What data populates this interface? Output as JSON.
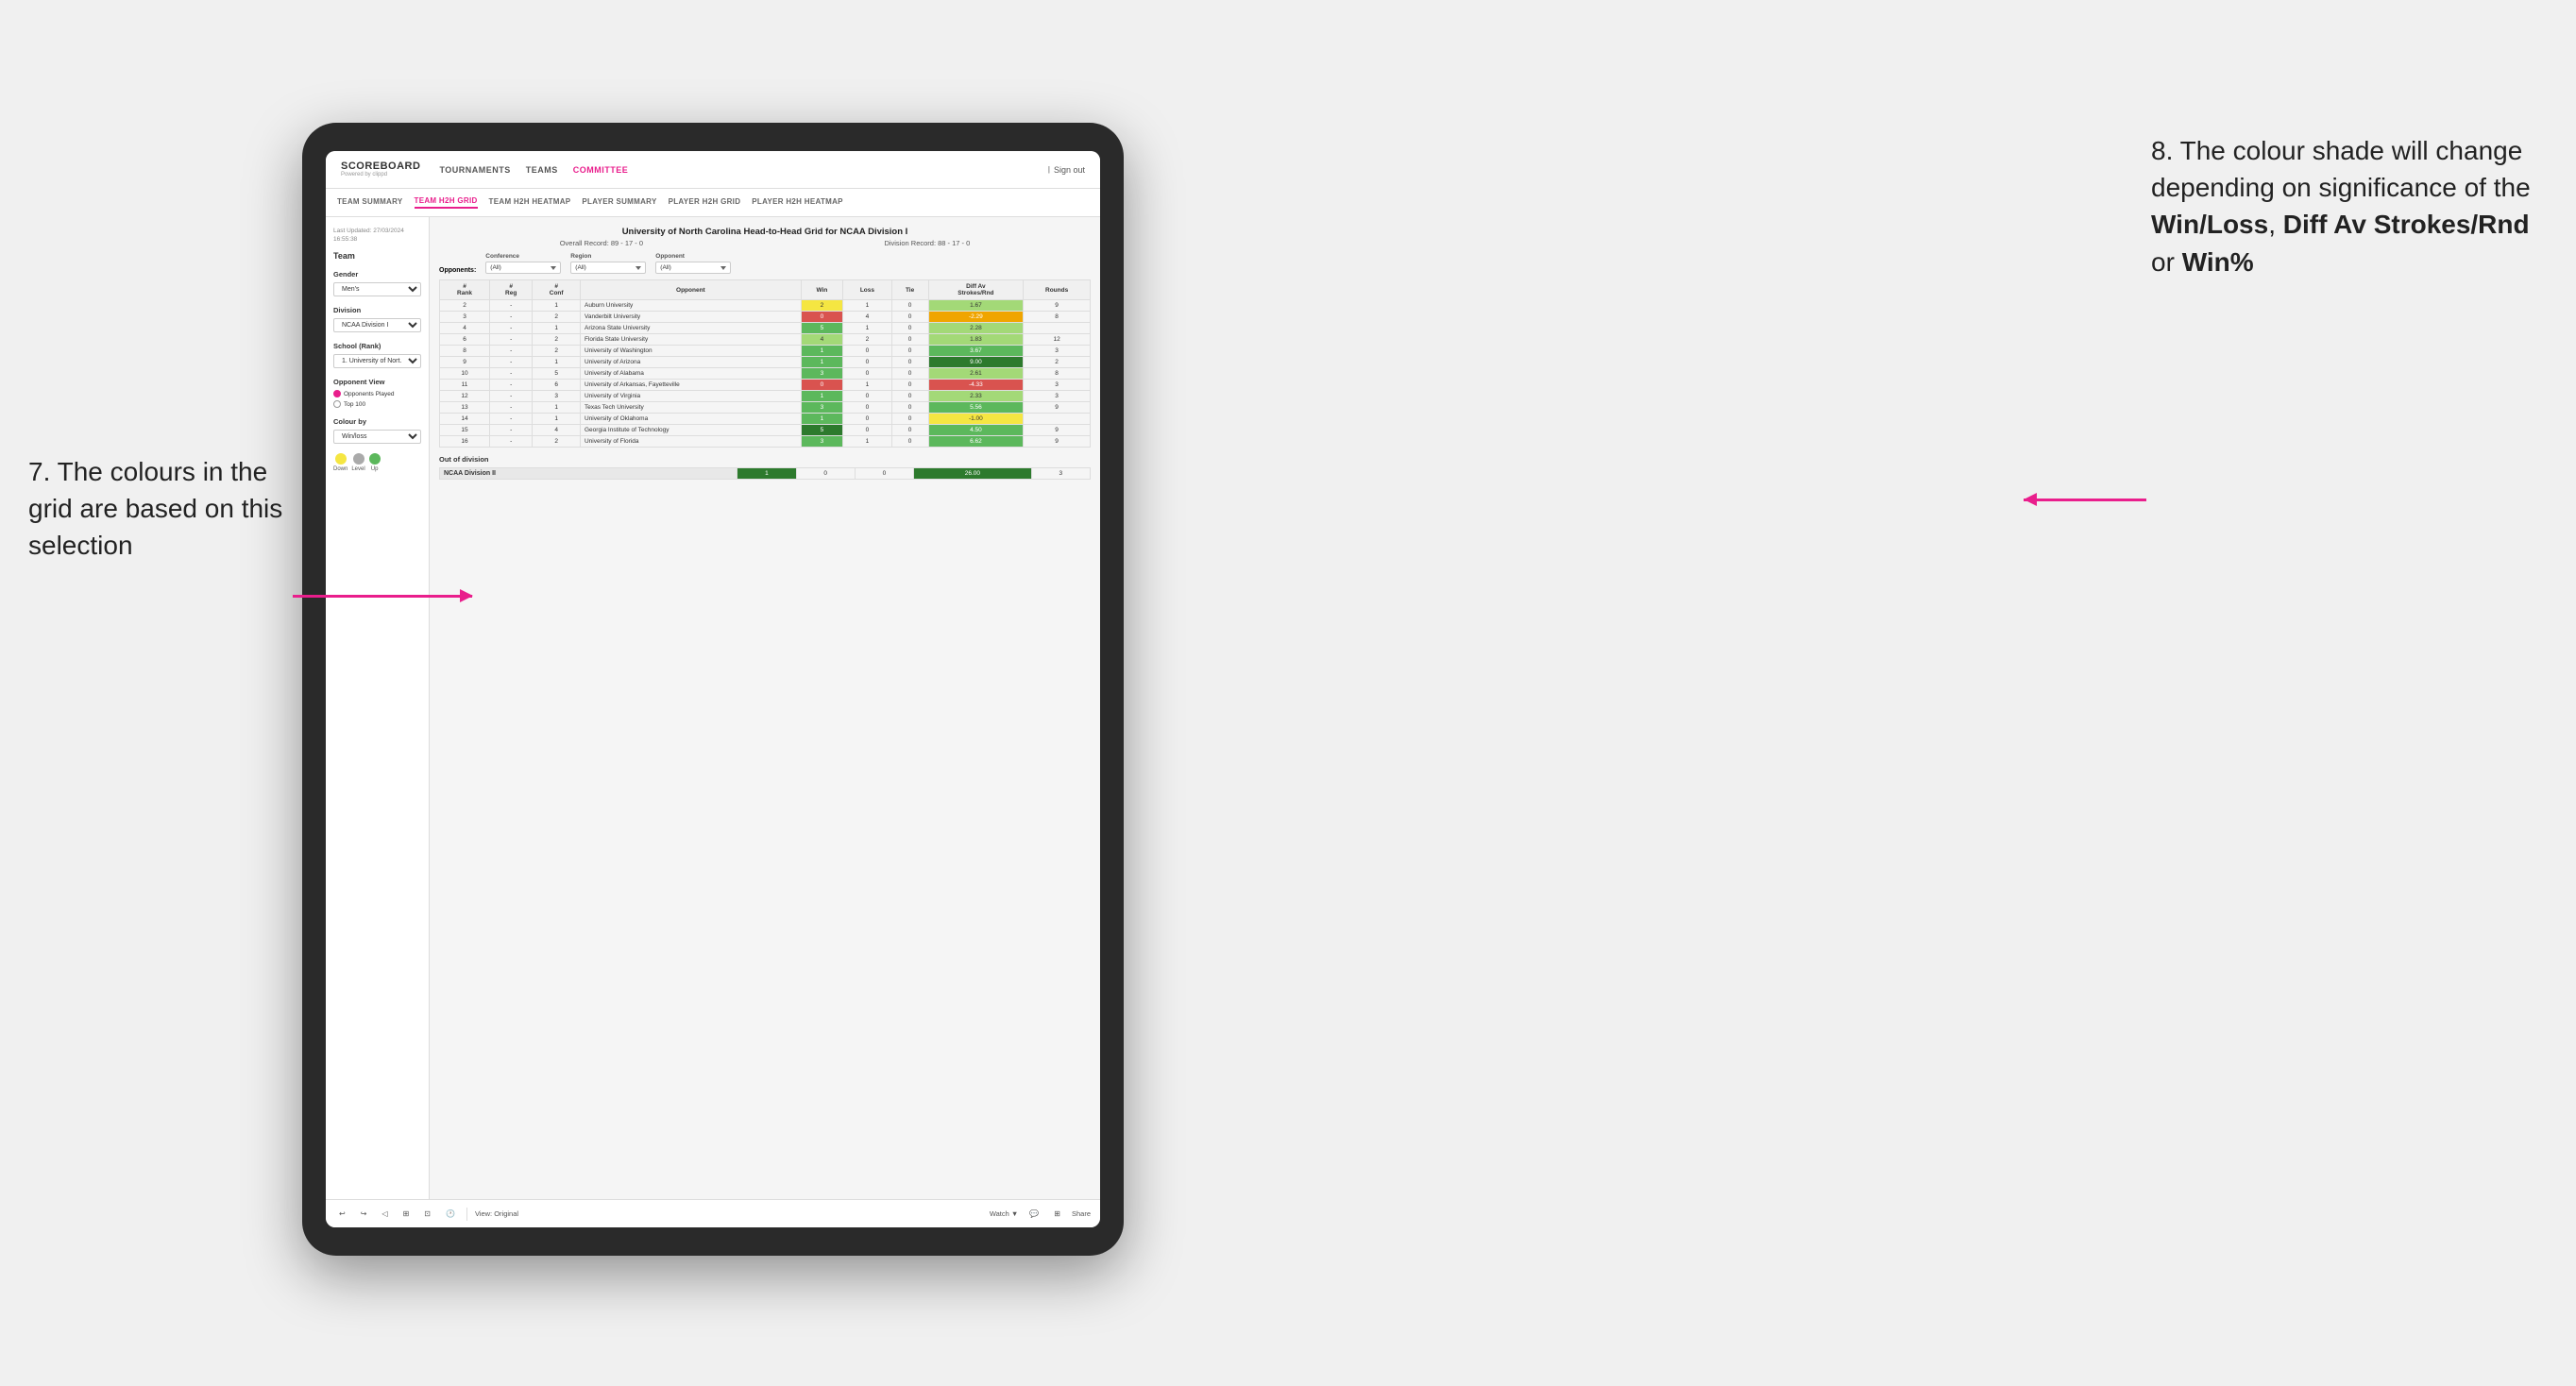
{
  "annotations": {
    "left_text": "7. The colours in the grid are based on this selection",
    "right_text_1": "8. The colour shade will change depending on significance of the",
    "right_bold_1": "Win/Loss",
    "right_bold_2": "Diff Av Strokes/Rnd",
    "right_text_2": "or",
    "right_bold_3": "Win%"
  },
  "nav": {
    "logo": "SCOREBOARD",
    "logo_sub": "Powered by clippd",
    "items": [
      "TOURNAMENTS",
      "TEAMS",
      "COMMITTEE"
    ],
    "sign_out": "Sign out"
  },
  "sub_nav": {
    "items": [
      "TEAM SUMMARY",
      "TEAM H2H GRID",
      "TEAM H2H HEATMAP",
      "PLAYER SUMMARY",
      "PLAYER H2H GRID",
      "PLAYER H2H HEATMAP"
    ],
    "active": "TEAM H2H GRID"
  },
  "left_panel": {
    "last_updated_label": "Last Updated: 27/03/2024",
    "last_updated_time": "16:55:38",
    "team_label": "Team",
    "gender_label": "Gender",
    "gender_value": "Men's",
    "division_label": "Division",
    "division_value": "NCAA Division I",
    "school_label": "School (Rank)",
    "school_value": "1. University of Nort...",
    "opponent_view_label": "Opponent View",
    "radio_options": [
      "Opponents Played",
      "Top 100"
    ],
    "radio_checked": "Opponents Played",
    "colour_by_label": "Colour by",
    "colour_by_value": "Win/loss",
    "legend": {
      "down_label": "Down",
      "level_label": "Level",
      "up_label": "Up",
      "down_color": "#f5e642",
      "level_color": "#aaaaaa",
      "up_color": "#5cb85c"
    }
  },
  "grid": {
    "title": "University of North Carolina Head-to-Head Grid for NCAA Division I",
    "overall_record": "Overall Record: 89 - 17 - 0",
    "division_record": "Division Record: 88 - 17 - 0",
    "filters": {
      "opponents_label": "Opponents:",
      "conference_label": "Conference",
      "conference_value": "(All)",
      "region_label": "Region",
      "region_value": "(All)",
      "opponent_label": "Opponent",
      "opponent_value": "(All)"
    },
    "table_headers": [
      "#\nRank",
      "#\nReg",
      "#\nConf",
      "Opponent",
      "Win",
      "Loss",
      "Tie",
      "Diff Av\nStrokes/Rnd",
      "Rounds"
    ],
    "rows": [
      {
        "rank": "2",
        "reg": "-",
        "conf": "1",
        "opponent": "Auburn University",
        "win": "2",
        "loss": "1",
        "tie": "0",
        "diff": "1.67",
        "rounds": "9",
        "win_color": "yellow",
        "diff_color": "green_light"
      },
      {
        "rank": "3",
        "reg": "-",
        "conf": "2",
        "opponent": "Vanderbilt University",
        "win": "0",
        "loss": "4",
        "tie": "0",
        "diff": "-2.29",
        "rounds": "8",
        "win_color": "red",
        "diff_color": "orange"
      },
      {
        "rank": "4",
        "reg": "-",
        "conf": "1",
        "opponent": "Arizona State University",
        "win": "5",
        "loss": "1",
        "tie": "0",
        "diff": "2.28",
        "rounds": "",
        "win_color": "green_mid",
        "diff_color": "green_light"
      },
      {
        "rank": "6",
        "reg": "-",
        "conf": "2",
        "opponent": "Florida State University",
        "win": "4",
        "loss": "2",
        "tie": "0",
        "diff": "1.83",
        "rounds": "12",
        "win_color": "green_light",
        "diff_color": "green_light"
      },
      {
        "rank": "8",
        "reg": "-",
        "conf": "2",
        "opponent": "University of Washington",
        "win": "1",
        "loss": "0",
        "tie": "0",
        "diff": "3.67",
        "rounds": "3",
        "win_color": "green_mid",
        "diff_color": "green_mid"
      },
      {
        "rank": "9",
        "reg": "-",
        "conf": "1",
        "opponent": "University of Arizona",
        "win": "1",
        "loss": "0",
        "tie": "0",
        "diff": "9.00",
        "rounds": "2",
        "win_color": "green_mid",
        "diff_color": "green_dark"
      },
      {
        "rank": "10",
        "reg": "-",
        "conf": "5",
        "opponent": "University of Alabama",
        "win": "3",
        "loss": "0",
        "tie": "0",
        "diff": "2.61",
        "rounds": "8",
        "win_color": "green_mid",
        "diff_color": "green_light"
      },
      {
        "rank": "11",
        "reg": "-",
        "conf": "6",
        "opponent": "University of Arkansas, Fayetteville",
        "win": "0",
        "loss": "1",
        "tie": "0",
        "diff": "-4.33",
        "rounds": "3",
        "win_color": "red",
        "diff_color": "red"
      },
      {
        "rank": "12",
        "reg": "-",
        "conf": "3",
        "opponent": "University of Virginia",
        "win": "1",
        "loss": "0",
        "tie": "0",
        "diff": "2.33",
        "rounds": "3",
        "win_color": "green_mid",
        "diff_color": "green_light"
      },
      {
        "rank": "13",
        "reg": "-",
        "conf": "1",
        "opponent": "Texas Tech University",
        "win": "3",
        "loss": "0",
        "tie": "0",
        "diff": "5.56",
        "rounds": "9",
        "win_color": "green_mid",
        "diff_color": "green_mid"
      },
      {
        "rank": "14",
        "reg": "-",
        "conf": "1",
        "opponent": "University of Oklahoma",
        "win": "1",
        "loss": "0",
        "tie": "0",
        "diff": "-1.00",
        "rounds": "",
        "win_color": "green_mid",
        "diff_color": "yellow"
      },
      {
        "rank": "15",
        "reg": "-",
        "conf": "4",
        "opponent": "Georgia Institute of Technology",
        "win": "5",
        "loss": "0",
        "tie": "0",
        "diff": "4.50",
        "rounds": "9",
        "win_color": "green_dark",
        "diff_color": "green_mid"
      },
      {
        "rank": "16",
        "reg": "-",
        "conf": "2",
        "opponent": "University of Florida",
        "win": "3",
        "loss": "1",
        "tie": "0",
        "diff": "6.62",
        "rounds": "9",
        "win_color": "green_mid",
        "diff_color": "green_mid"
      }
    ],
    "out_of_division_title": "Out of division",
    "out_of_division_rows": [
      {
        "division": "NCAA Division II",
        "win": "1",
        "loss": "0",
        "tie": "0",
        "diff": "26.00",
        "rounds": "3",
        "win_color": "green_dark",
        "diff_color": "green_dark"
      }
    ]
  },
  "toolbar": {
    "view_label": "View: Original",
    "watch_label": "Watch ▼",
    "share_label": "Share"
  }
}
